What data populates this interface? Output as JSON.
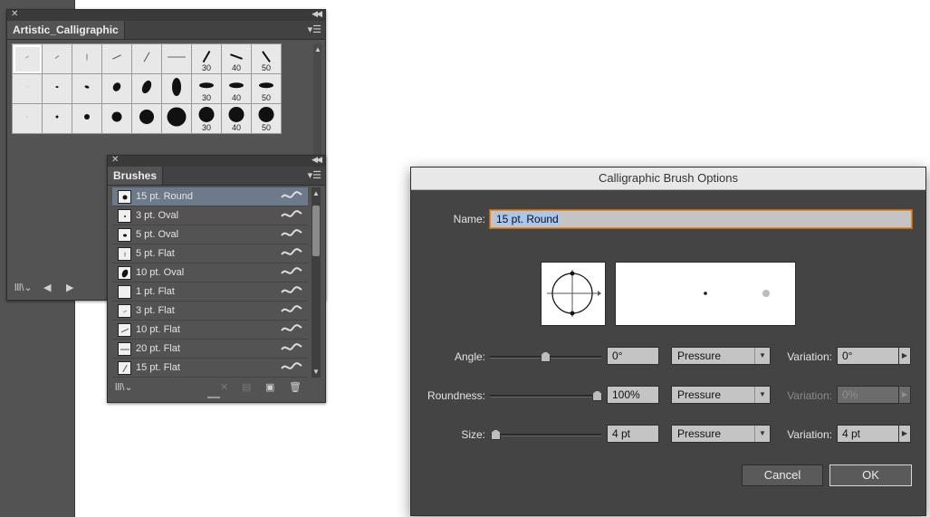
{
  "artistic_panel": {
    "tab_label": "Artistic_Calligraphic",
    "grid_labels": [
      "30",
      "40",
      "50"
    ]
  },
  "brushes_panel": {
    "tab_label": "Brushes",
    "items": [
      {
        "label": "15 pt. Round",
        "selected": true
      },
      {
        "label": "3 pt. Oval"
      },
      {
        "label": "5 pt. Oval"
      },
      {
        "label": "5 pt. Flat"
      },
      {
        "label": "10 pt. Oval"
      },
      {
        "label": "1 pt. Flat"
      },
      {
        "label": "3 pt. Flat"
      },
      {
        "label": "10 pt. Flat"
      },
      {
        "label": "20 pt. Flat"
      },
      {
        "label": "15 pt. Flat"
      }
    ]
  },
  "dialog": {
    "title": "Calligraphic Brush Options",
    "name_label": "Name:",
    "name_value": "15 pt. Round",
    "angle": {
      "label": "Angle:",
      "value": "0°",
      "variation_type": "Pressure",
      "variation_label": "Variation:",
      "variation_value": "0°"
    },
    "roundness": {
      "label": "Roundness:",
      "value": "100%",
      "variation_type": "Pressure",
      "variation_label": "Variation:",
      "variation_value": "0%"
    },
    "size": {
      "label": "Size:",
      "value": "4 pt",
      "variation_type": "Pressure",
      "variation_label": "Variation:",
      "variation_value": "4 pt"
    },
    "cancel_label": "Cancel",
    "ok_label": "OK"
  },
  "colors": {
    "panel_bg": "#535353",
    "dialog_bg": "#444444",
    "selection_blue": "#6c7a8c",
    "name_focus_orange": "#e68a2e"
  }
}
